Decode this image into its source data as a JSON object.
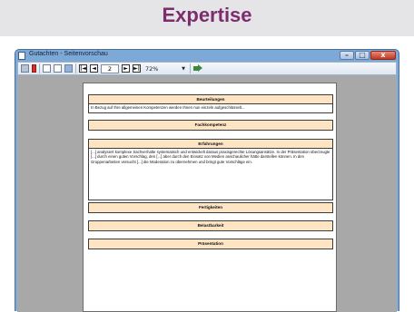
{
  "banner": {
    "title": "Expertise"
  },
  "window": {
    "title": "Gutachten - Seitenvorschau",
    "controls": {
      "minimize": "–",
      "maximize": "□",
      "close": "x"
    }
  },
  "toolbar": {
    "icons": [
      "print-icon",
      "export-icon",
      "single-page-icon",
      "multi-page-icon",
      "page-setup-icon",
      "first-page-icon",
      "prev-page-icon",
      "next-page-icon",
      "last-page-icon",
      "go-icon"
    ],
    "first": "|◄",
    "prev": "◄",
    "page": "2",
    "next": "►",
    "last": "►|",
    "zoom": "72%",
    "zoom_arrow": "▼"
  },
  "document": {
    "sections": [
      {
        "title": "Beurteilungen",
        "body": "In Bezug auf Ihre allgemeinen Kompetenzen werden Ihnen nun einzeln aufgeschlüsselt..."
      },
      {
        "title": "Fachkompetenz"
      },
      {
        "title": "Erfahrungen",
        "body": "[...] analysiert komplexe Sachverhalte systematisch und entwickelt daraus praxisgerechte Lösungsansätze. In der Präsentation überzeugte [...] durch einen guten Vorschlag, den [...] aber durch den Einsatz von Medien anschaulicher hätte darstellen können. In den Gruppenarbeiten versucht [...] die Moderation zu übernehmen und bringt gute Vorschläge ein."
      },
      {
        "title": "Fertigkeiten"
      },
      {
        "title": "Belastbarkeit"
      },
      {
        "title": "Präsentation"
      }
    ]
  }
}
